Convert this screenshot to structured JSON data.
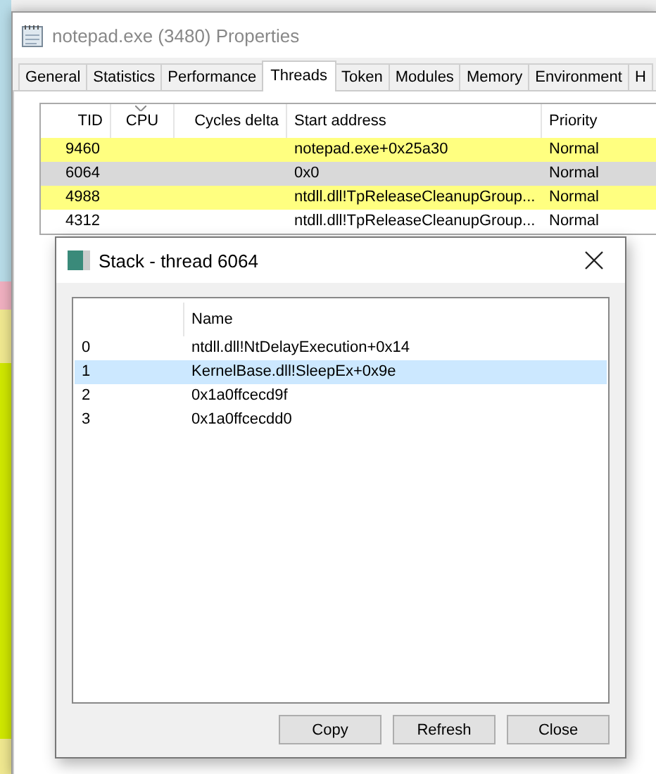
{
  "window": {
    "title": "notepad.exe (3480) Properties"
  },
  "tabs": [
    {
      "label": "General",
      "selected": false
    },
    {
      "label": "Statistics",
      "selected": false
    },
    {
      "label": "Performance",
      "selected": false
    },
    {
      "label": "Threads",
      "selected": true
    },
    {
      "label": "Token",
      "selected": false
    },
    {
      "label": "Modules",
      "selected": false
    },
    {
      "label": "Memory",
      "selected": false
    },
    {
      "label": "Environment",
      "selected": false
    },
    {
      "label": "H",
      "selected": false
    }
  ],
  "threads": {
    "columns": [
      "TID",
      "CPU",
      "Cycles delta",
      "Start address",
      "Priority"
    ],
    "rows": [
      {
        "tid": "9460",
        "start_address": "notepad.exe+0x25a30",
        "priority": "Normal",
        "color": "#ffff80",
        "selected": false
      },
      {
        "tid": "6064",
        "start_address": "0x0",
        "priority": "Normal",
        "selected": true
      },
      {
        "tid": "4988",
        "start_address": "ntdll.dll!TpReleaseCleanupGroup...",
        "priority": "Normal",
        "color": "#ffff80",
        "selected": false
      },
      {
        "tid": "4312",
        "start_address": "ntdll.dll!TpReleaseCleanupGroup...",
        "priority": "Normal",
        "color": "#ffffff",
        "selected": false
      }
    ]
  },
  "dialog": {
    "title": "Stack - thread 6064",
    "columns": [
      "Name"
    ],
    "frames": [
      {
        "index": "0",
        "name": "ntdll.dll!NtDelayExecution+0x14",
        "selected": false
      },
      {
        "index": "1",
        "name": "KernelBase.dll!SleepEx+0x9e",
        "selected": true
      },
      {
        "index": "2",
        "name": "0x1a0ffcecd9f",
        "selected": false
      },
      {
        "index": "3",
        "name": "0x1a0ffcecdd0",
        "selected": false
      }
    ],
    "buttons": [
      "Copy",
      "Refresh",
      "Close"
    ]
  }
}
